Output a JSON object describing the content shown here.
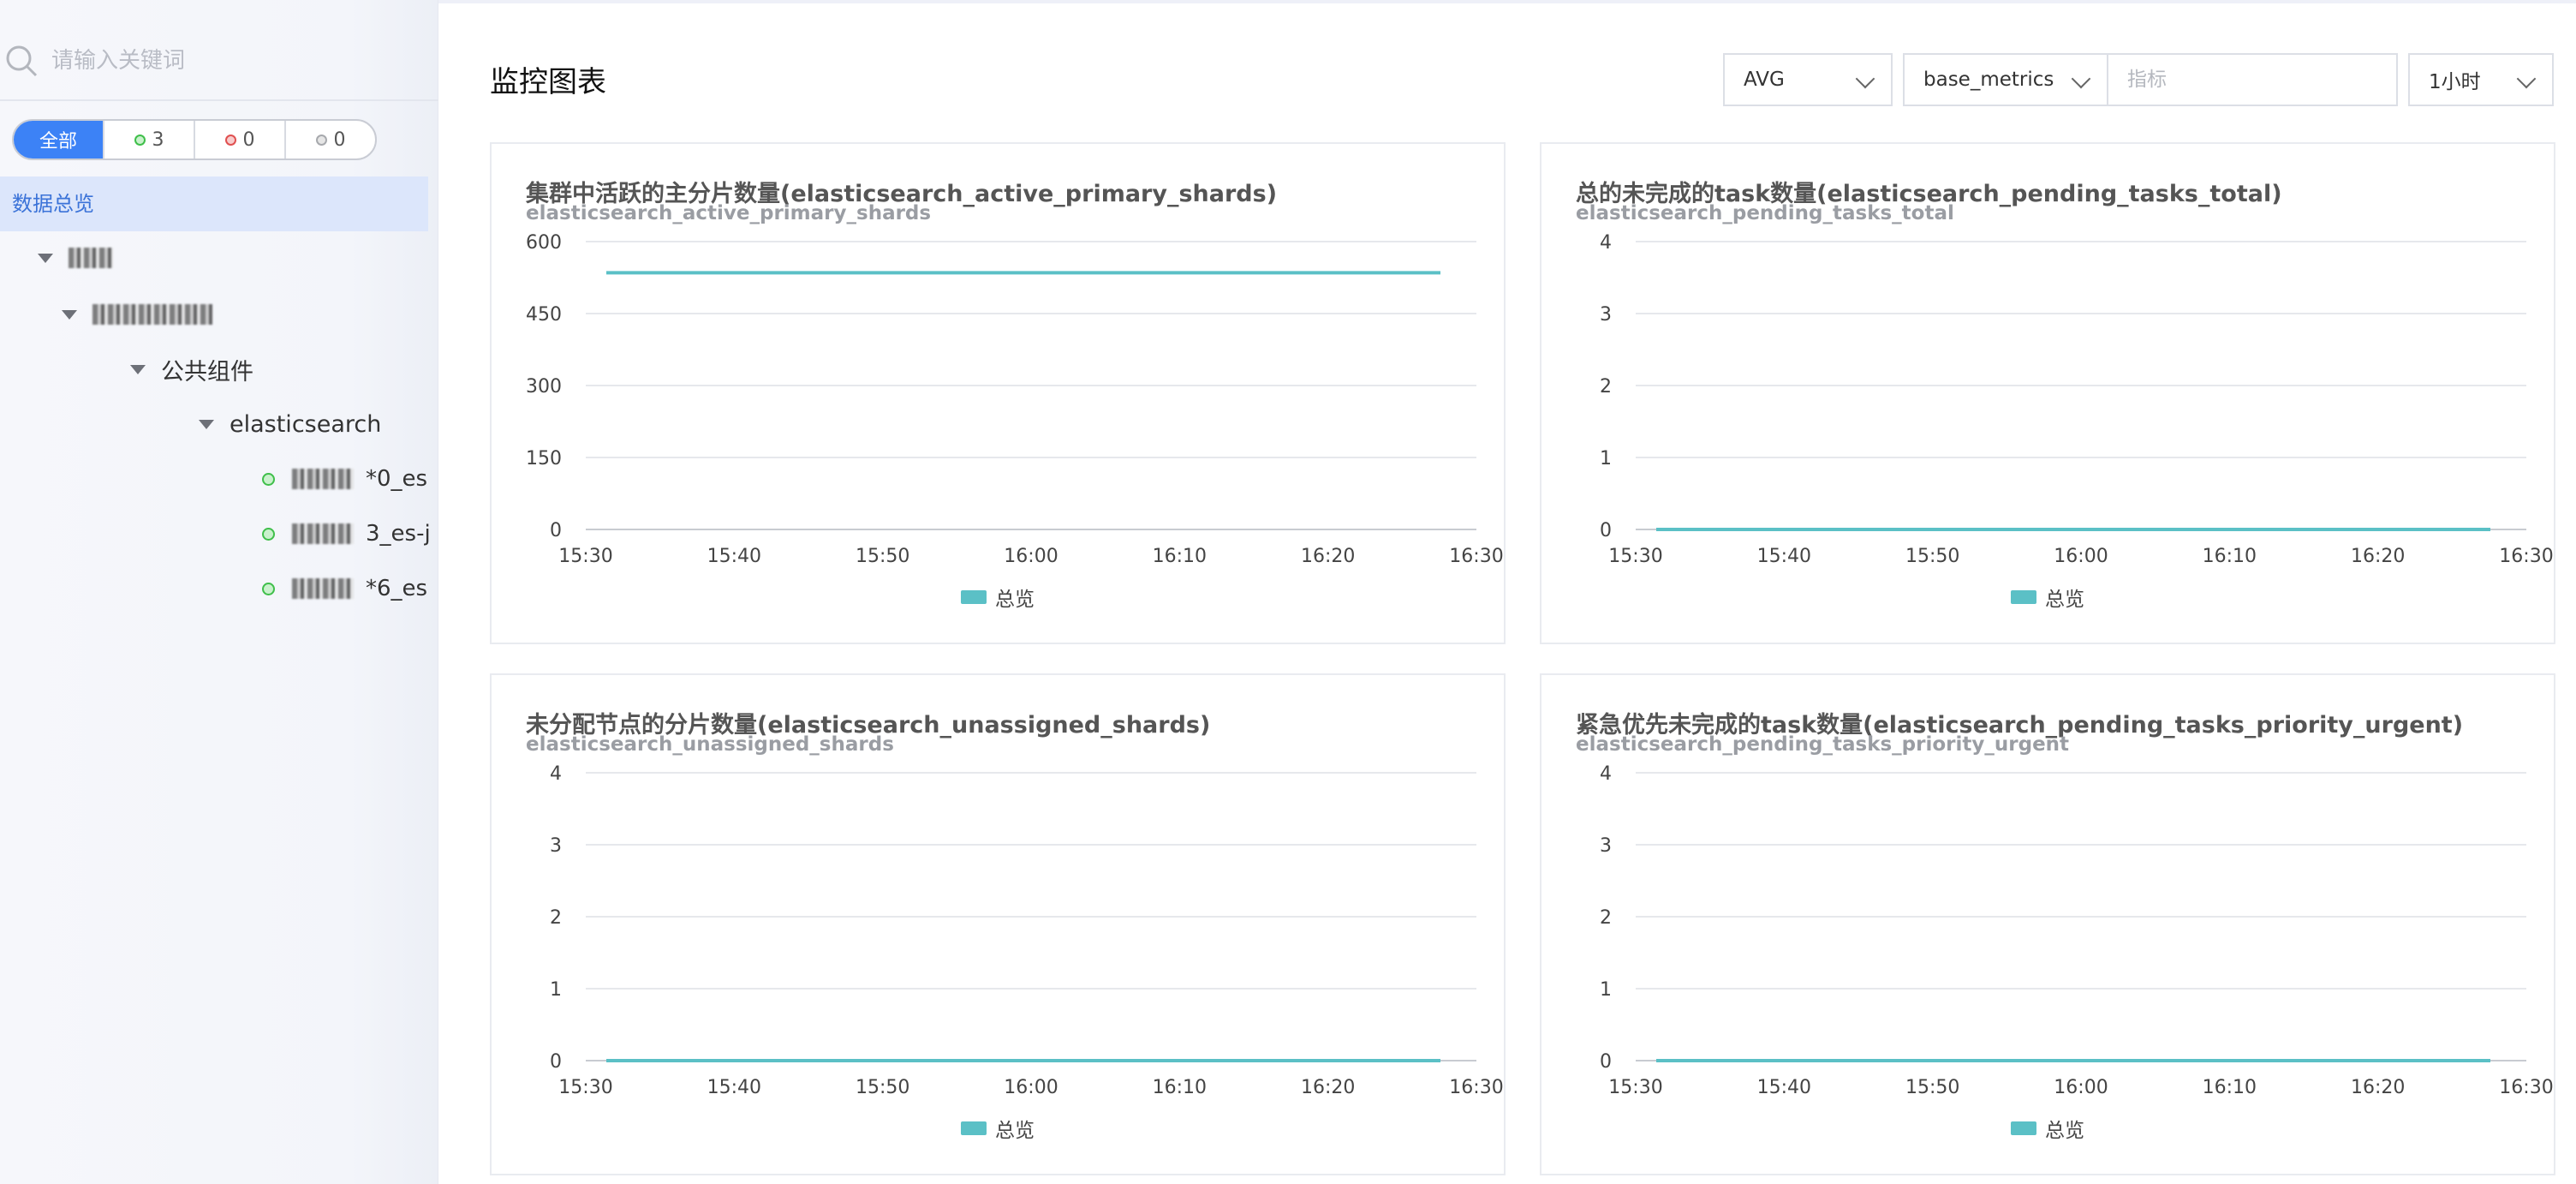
{
  "search": {
    "placeholder": "请输入关键词"
  },
  "filters": [
    {
      "label": "全部"
    },
    {
      "label": "3"
    },
    {
      "label": "0"
    },
    {
      "label": "0"
    }
  ],
  "sidebar": {
    "overview": "数据总览",
    "tree": {
      "group_label": "公共组件",
      "service_label": "elasticsearch",
      "leaves": [
        {
          "suffix": "*0_es"
        },
        {
          "suffix": "3_es-j"
        },
        {
          "suffix": "*6_es"
        }
      ]
    }
  },
  "header": {
    "title": "监控图表",
    "aggregate": "AVG",
    "metric_group": "base_metrics",
    "metric_placeholder": "指标",
    "time_range": "1小时"
  },
  "colors": {
    "accent": "#3c82f6",
    "series": "#5bc0c6",
    "online": "#3fbf4a",
    "offline": "#e05050"
  },
  "chart_data": [
    {
      "type": "line",
      "title": "集群中活跃的主分片数量(elasticsearch_active_primary_shards)",
      "subtitle": "elasticsearch_active_primary_shards",
      "ylim": [
        0,
        600
      ],
      "yticks": [
        "600",
        "450",
        "300",
        "150",
        "0"
      ],
      "xticks": [
        "15:30",
        "15:40",
        "15:50",
        "16:00",
        "16:10",
        "16:20",
        "16:30"
      ],
      "series": [
        {
          "name": "总览",
          "x": [
            "15:30",
            "16:30"
          ],
          "values": [
            535,
            535
          ]
        }
      ]
    },
    {
      "type": "line",
      "title": "总的未完成的task数量(elasticsearch_pending_tasks_total)",
      "subtitle": "elasticsearch_pending_tasks_total",
      "ylim": [
        0,
        4
      ],
      "yticks": [
        "4",
        "3",
        "2",
        "1",
        "0"
      ],
      "xticks": [
        "15:30",
        "15:40",
        "15:50",
        "16:00",
        "16:10",
        "16:20",
        "16:30"
      ],
      "series": [
        {
          "name": "总览",
          "x": [
            "15:30",
            "16:30"
          ],
          "values": [
            0,
            0
          ]
        }
      ]
    },
    {
      "type": "line",
      "title": "未分配节点的分片数量(elasticsearch_unassigned_shards)",
      "subtitle": "elasticsearch_unassigned_shards",
      "ylim": [
        0,
        4
      ],
      "yticks": [
        "4",
        "3",
        "2",
        "1",
        "0"
      ],
      "xticks": [
        "15:30",
        "15:40",
        "15:50",
        "16:00",
        "16:10",
        "16:20",
        "16:30"
      ],
      "series": [
        {
          "name": "总览",
          "x": [
            "15:30",
            "16:30"
          ],
          "values": [
            0,
            0
          ]
        }
      ]
    },
    {
      "type": "line",
      "title": "紧急优先未完成的task数量(elasticsearch_pending_tasks_priority_urgent)",
      "subtitle": "elasticsearch_pending_tasks_priority_urgent",
      "ylim": [
        0,
        4
      ],
      "yticks": [
        "4",
        "3",
        "2",
        "1",
        "0"
      ],
      "xticks": [
        "15:30",
        "15:40",
        "15:50",
        "16:00",
        "16:10",
        "16:20",
        "16:30"
      ],
      "series": [
        {
          "name": "总览",
          "x": [
            "15:30",
            "16:30"
          ],
          "values": [
            0,
            0
          ]
        }
      ]
    }
  ]
}
